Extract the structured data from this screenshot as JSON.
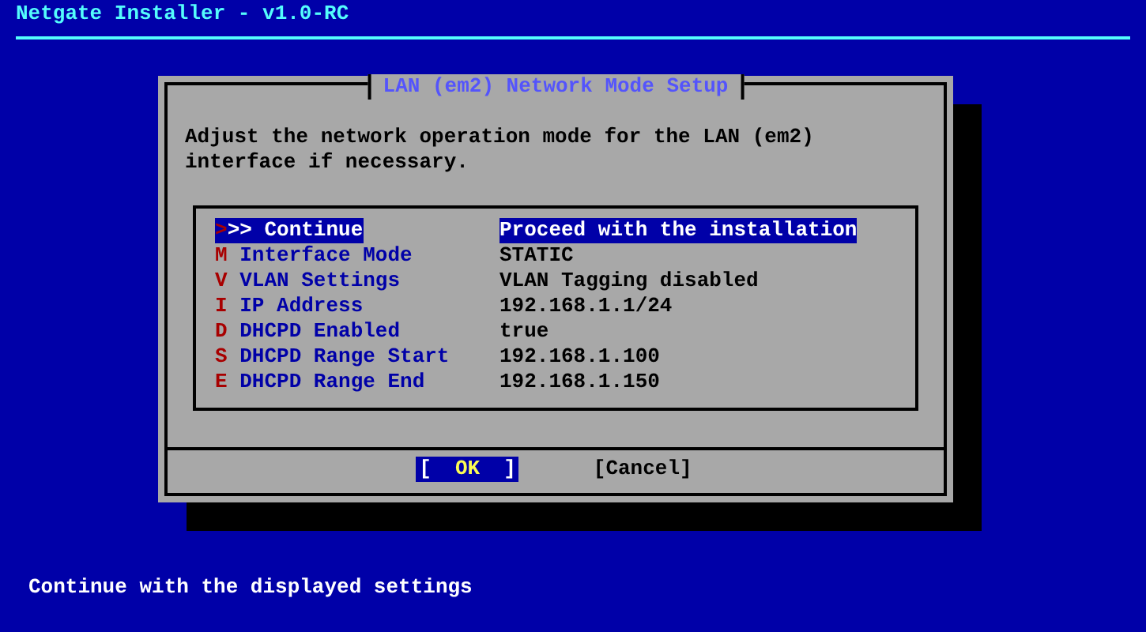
{
  "header": {
    "title": "Netgate Installer - v1.0-RC"
  },
  "dialog": {
    "title": "LAN (em2) Network Mode Setup",
    "message": "Adjust the network operation mode for the LAN (em2) interface if necessary.",
    "menu": [
      {
        "kind": "action",
        "key": ">",
        "name": ">> Continue",
        "value": "Proceed with the installation",
        "selected": true
      },
      {
        "kind": "setting",
        "key": "M",
        "name": "Interface Mode",
        "value": "STATIC",
        "selected": false
      },
      {
        "kind": "setting",
        "key": "V",
        "name": "VLAN Settings",
        "value": "VLAN Tagging disabled",
        "selected": false
      },
      {
        "kind": "setting",
        "key": "I",
        "name": "IP Address",
        "value": "192.168.1.1/24",
        "selected": false
      },
      {
        "kind": "setting",
        "key": "D",
        "name": "DHCPD Enabled",
        "value": "true",
        "selected": false
      },
      {
        "kind": "setting",
        "key": "S",
        "name": "DHCPD Range Start",
        "value": "192.168.1.100",
        "selected": false
      },
      {
        "kind": "setting",
        "key": "E",
        "name": "DHCPD Range End",
        "value": "192.168.1.150",
        "selected": false
      }
    ],
    "buttons": [
      {
        "open": "[",
        "label": "OK",
        "close": "]",
        "selected": true
      },
      {
        "open": "[",
        "label": "Cancel",
        "close": "]",
        "selected": false
      }
    ]
  },
  "status_bar": "Continue with the displayed settings"
}
